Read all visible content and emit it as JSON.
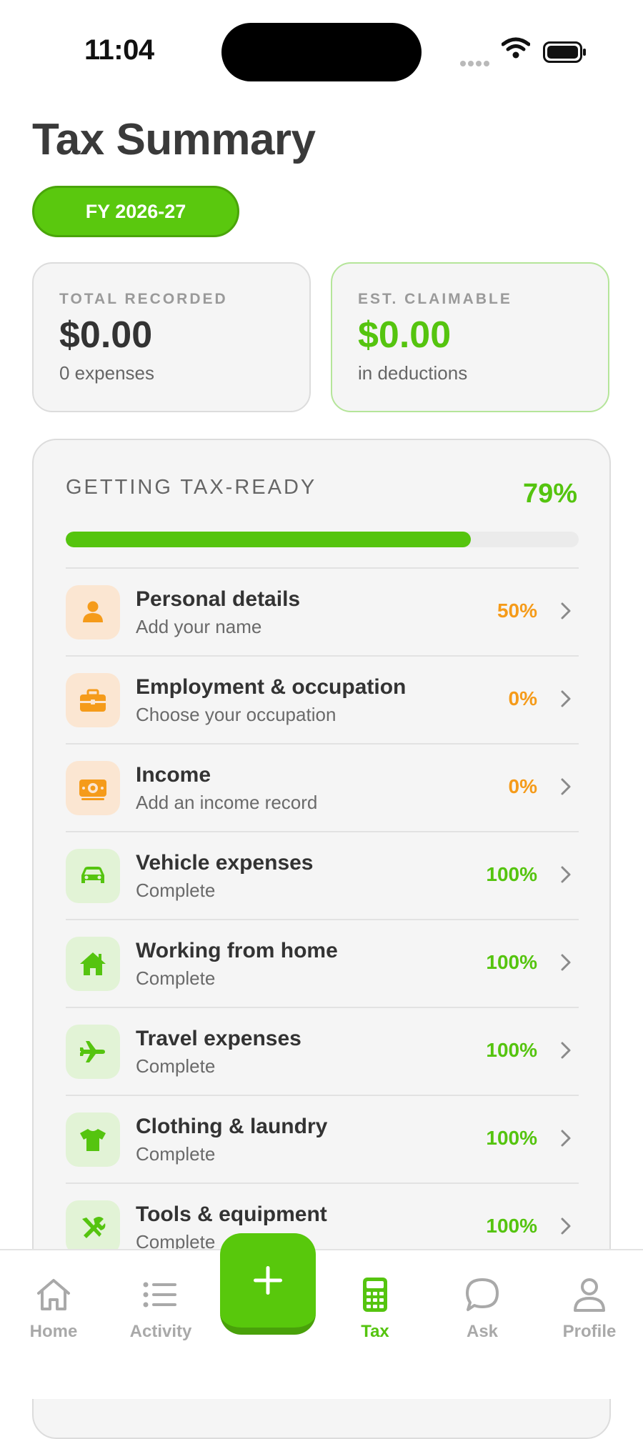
{
  "status_bar": {
    "time": "11:04"
  },
  "header": {
    "title": "Tax Summary",
    "fy_badge": "FY 2026-27"
  },
  "summary": {
    "total_recorded": {
      "label": "TOTAL RECORDED",
      "value": "$0.00",
      "sub": "0 expenses"
    },
    "est_claimable": {
      "label": "EST. CLAIMABLE",
      "value": "$0.00",
      "sub": "in deductions"
    }
  },
  "tax_ready": {
    "title": "GETTING TAX-READY",
    "percent_label": "79%",
    "progress": 0.79,
    "items": [
      {
        "title": "Personal details",
        "subtitle": "Add your name",
        "percent": "50%",
        "icon": "person-icon",
        "tone": "orange"
      },
      {
        "title": "Employment & occupation",
        "subtitle": "Choose your occupation",
        "percent": "0%",
        "icon": "briefcase-icon",
        "tone": "orange"
      },
      {
        "title": "Income",
        "subtitle": "Add an income record",
        "percent": "0%",
        "icon": "money-icon",
        "tone": "orange"
      },
      {
        "title": "Vehicle expenses",
        "subtitle": "Complete",
        "percent": "100%",
        "icon": "car-icon",
        "tone": "green"
      },
      {
        "title": "Working from home",
        "subtitle": "Complete",
        "percent": "100%",
        "icon": "home-icon",
        "tone": "green"
      },
      {
        "title": "Travel expenses",
        "subtitle": "Complete",
        "percent": "100%",
        "icon": "airplane-icon",
        "tone": "green"
      },
      {
        "title": "Clothing & laundry",
        "subtitle": "Complete",
        "percent": "100%",
        "icon": "shirt-icon",
        "tone": "green"
      },
      {
        "title": "Tools & equipment",
        "subtitle": "Complete",
        "percent": "100%",
        "icon": "tools-icon",
        "tone": "green"
      }
    ]
  },
  "tab_bar": {
    "tabs": [
      {
        "label": "Home",
        "icon": "home-icon"
      },
      {
        "label": "Activity",
        "icon": "list-icon"
      },
      {
        "label": "Tax",
        "icon": "calculator-icon",
        "active": true
      },
      {
        "label": "Ask",
        "icon": "chat-bubble-icon"
      },
      {
        "label": "Profile",
        "icon": "person-icon"
      }
    ],
    "fab_icon": "plus-icon"
  },
  "colors": {
    "accent_green": "#55c40f",
    "warning_orange": "#f59b1a",
    "text_dark": "#333333"
  }
}
